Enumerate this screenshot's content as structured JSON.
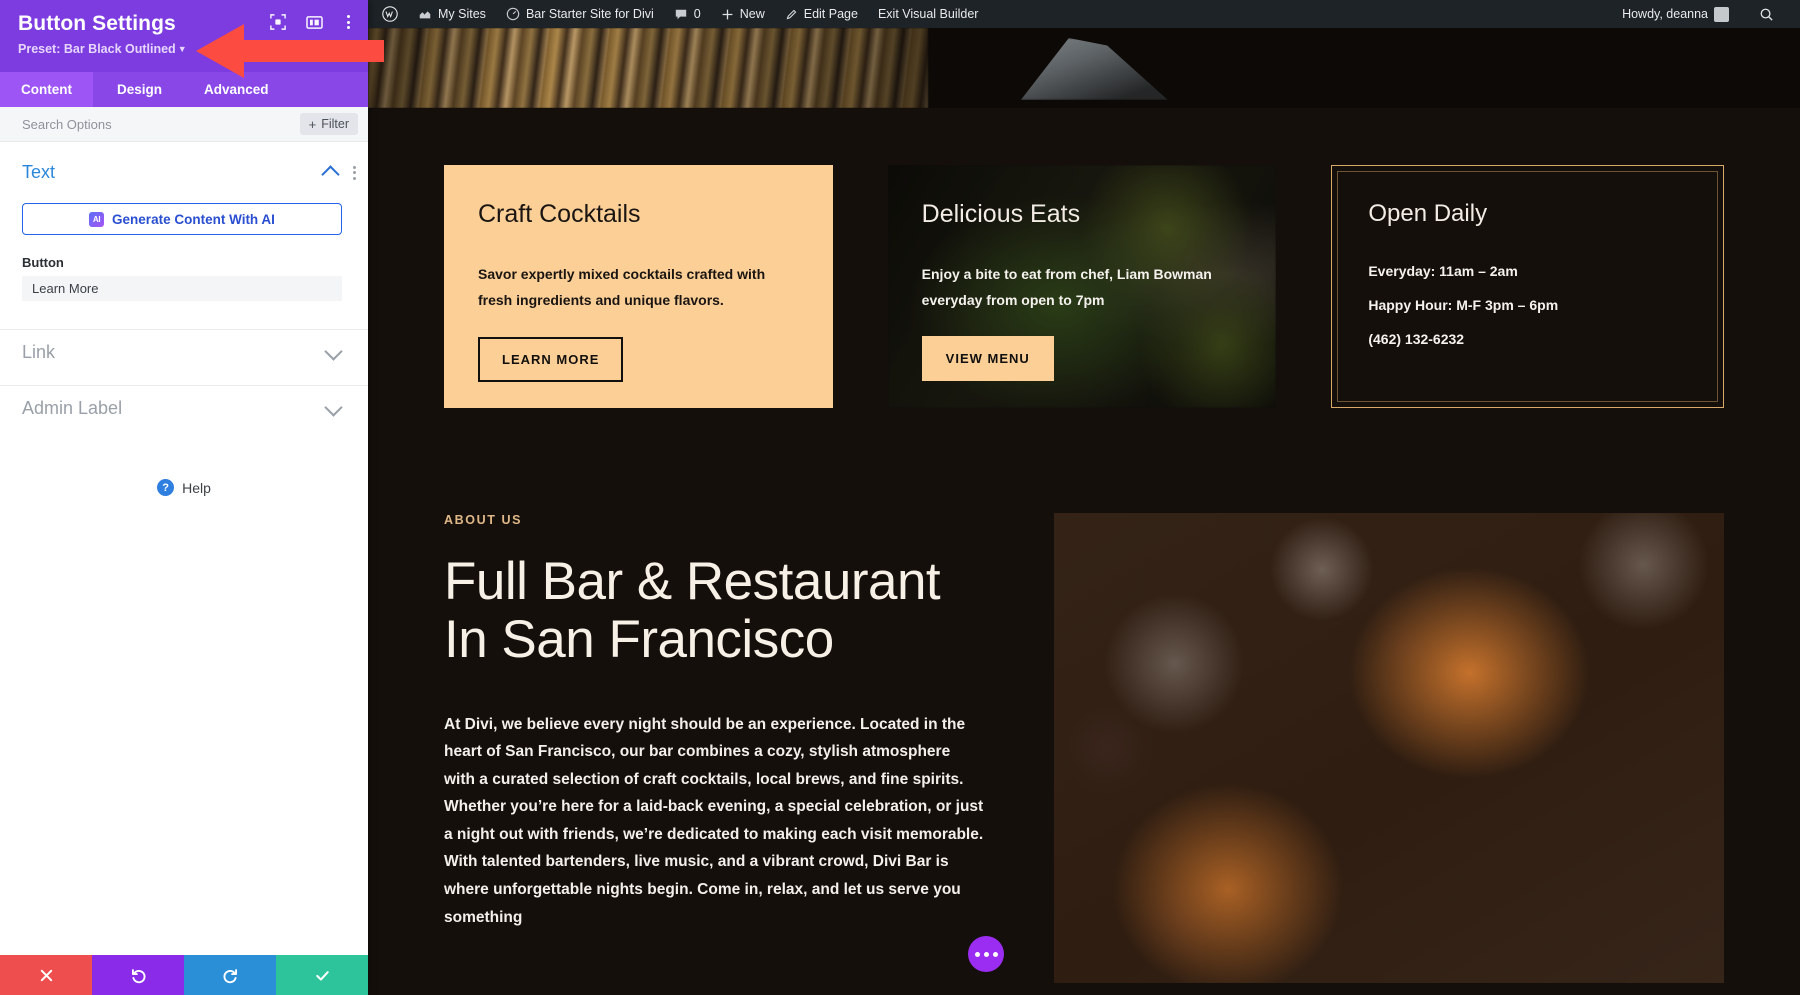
{
  "settings_panel": {
    "title": "Button Settings",
    "preset_label": "Preset: Bar Black Outlined",
    "header_icons": [
      "target-focus-icon",
      "panel-layout-icon",
      "vertical-dots-icon"
    ],
    "tabs": [
      {
        "label": "Content",
        "active": true
      },
      {
        "label": "Design",
        "active": false
      },
      {
        "label": "Advanced",
        "active": false
      }
    ],
    "search": {
      "placeholder": "Search Options",
      "value": ""
    },
    "filter_button": "Filter",
    "sections": [
      {
        "name": "Text",
        "expanded": true
      },
      {
        "name": "Link",
        "expanded": false
      },
      {
        "name": "Admin Label",
        "expanded": false
      }
    ],
    "ai_button": {
      "label": "Generate Content With AI",
      "badge": "AI"
    },
    "button_field": {
      "label": "Button",
      "value": "Learn More"
    },
    "help": "Help",
    "footer_actions": [
      {
        "name": "cancel",
        "icon": "close-icon",
        "color": "#ef4e4e"
      },
      {
        "name": "undo",
        "icon": "undo-icon",
        "color": "#8a2be9"
      },
      {
        "name": "redo",
        "icon": "redo-icon",
        "color": "#2b8fd8"
      },
      {
        "name": "save",
        "icon": "check-icon",
        "color": "#2ec49b"
      }
    ]
  },
  "admin_bar": {
    "wordpress_logo": "wordpress-icon",
    "items": [
      {
        "label": "My Sites",
        "icon": "sites-icon"
      },
      {
        "label": "Bar Starter Site for Divi",
        "icon": "dashboard-icon"
      },
      {
        "label": "0",
        "icon": "comment-icon"
      },
      {
        "label": "New",
        "icon": "plus-icon"
      },
      {
        "label": "Edit Page",
        "icon": "pencil-icon"
      },
      {
        "label": "Exit Visual Builder",
        "icon": ""
      }
    ],
    "greeting": "Howdy, deanna",
    "search_icon": "search-icon"
  },
  "page": {
    "cards": [
      {
        "heading": "Craft Cocktails",
        "body": "Savor expertly mixed cocktails crafted with fresh ingredients and unique flavors.",
        "button": "LEARN MORE",
        "style": "peach-outline"
      },
      {
        "heading": "Delicious Eats",
        "body": "Enjoy a bite to eat from chef, Liam Bowman everyday from open to 7pm",
        "button": "VIEW MENU",
        "style": "image-solid"
      },
      {
        "heading": "Open Daily",
        "lines": [
          "Everyday: 11am – 2am",
          "Happy Hour: M-F 3pm – 6pm",
          "(462) 132-6232"
        ],
        "style": "gold-border"
      }
    ],
    "about": {
      "eyebrow": "ABOUT US",
      "heading_line1": "Full Bar & Restaurant",
      "heading_line2": "In San Francisco",
      "paragraph": "At Divi, we believe every night should be an experience. Located in the heart of San Francisco, our bar combines a cozy, stylish atmosphere with a curated selection of craft cocktails, local brews, and fine spirits. Whether you’re here for a laid-back evening, a special celebration, or just a night out with friends, we’re dedicated to making each visit memorable. With talented bartenders, live music, and a vibrant crowd, Divi Bar is where unforgettable nights begin. Come in, relax, and let us serve you something"
    },
    "fab": "more-options-icon"
  },
  "annotation": {
    "arrow": "red-left-arrow",
    "color": "#fc4b41"
  },
  "colors": {
    "panel_purple": "#7d3ce0",
    "tab_purple": "#8a47e8",
    "accent_peach": "#fbcf96",
    "page_dark": "#150f0c",
    "gold_border": "#d8a96a"
  }
}
